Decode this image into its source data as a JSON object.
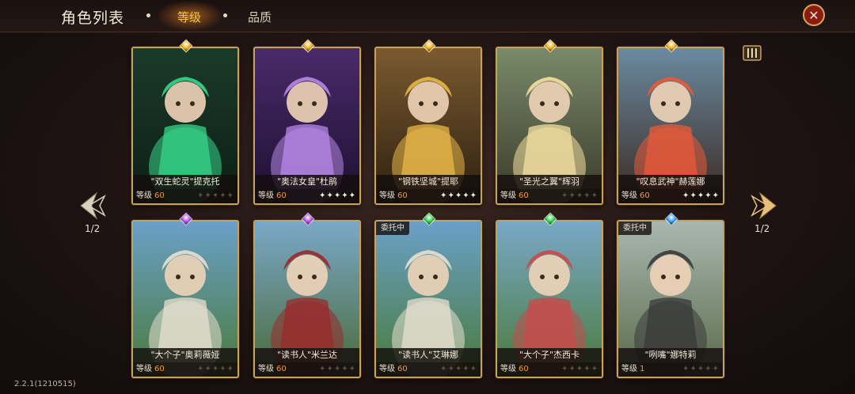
{
  "header": {
    "title": "角色列表",
    "tabs": [
      {
        "label": "等级",
        "active": true
      },
      {
        "label": "品质",
        "active": false
      }
    ],
    "close_icon": "close-icon"
  },
  "pagination": {
    "left": "1/2",
    "right": "1/2"
  },
  "version": "2.2.1(1210515)",
  "colors": {
    "accent": "#f5c24a",
    "level": "#f09a3a",
    "frame": "#c9a25a"
  },
  "cards": [
    {
      "name": "\"双生蛇灵\"提克托",
      "level_label": "等级",
      "level": "60",
      "stars": 0,
      "gem": "#f0b020",
      "tag": "",
      "bg": [
        "#1b3a2a",
        "#0d1f16"
      ],
      "accent": "#36d68a"
    },
    {
      "name": "\"奥法女皇\"杜鹃",
      "level_label": "等级",
      "level": "60",
      "stars": 5,
      "gem": "#f0b020",
      "tag": "",
      "bg": [
        "#4a2a6a",
        "#1c1030"
      ],
      "accent": "#b888e8"
    },
    {
      "name": "\"钢铁坚城\"提耶",
      "level_label": "等级",
      "level": "60",
      "stars": 5,
      "gem": "#f0b020",
      "tag": "",
      "bg": [
        "#7a5a30",
        "#2e2010"
      ],
      "accent": "#e8b848"
    },
    {
      "name": "\"圣光之翼\"辉羽",
      "level_label": "等级",
      "level": "60",
      "stars": 0,
      "gem": "#f0b020",
      "tag": "",
      "bg": [
        "#7a8a6a",
        "#3a3a28"
      ],
      "accent": "#f4e0a0"
    },
    {
      "name": "\"叹息武神\"赫莲娜",
      "level_label": "等级",
      "level": "60",
      "stars": 5,
      "gem": "#f0b020",
      "tag": "",
      "bg": [
        "#6a8aa0",
        "#3a2a22"
      ],
      "accent": "#e85a3a"
    },
    {
      "name": "\"大个子\"奥莉薇娅",
      "level_label": "等级",
      "level": "60",
      "stars": 0,
      "gem": "#b050e8",
      "tag": "",
      "bg": [
        "#6aa0c8",
        "#4a7a3a"
      ],
      "accent": "#e8e0d0"
    },
    {
      "name": "\"读书人\"米兰达",
      "level_label": "等级",
      "level": "60",
      "stars": 0,
      "gem": "#b050e8",
      "tag": "",
      "bg": [
        "#7aa8c8",
        "#4a6a3a"
      ],
      "accent": "#9a2a2a"
    },
    {
      "name": "\"读书人\"艾琳娜",
      "level_label": "等级",
      "level": "60",
      "stars": 0,
      "gem": "#30d050",
      "tag": "委托中",
      "bg": [
        "#6aa0c8",
        "#4a7a3a"
      ],
      "accent": "#e8e0d0"
    },
    {
      "name": "\"大个子\"杰西卡",
      "level_label": "等级",
      "level": "60",
      "stars": 0,
      "gem": "#30d050",
      "tag": "",
      "bg": [
        "#7aa8c8",
        "#4a7a3a"
      ],
      "accent": "#c84a4a"
    },
    {
      "name": "\"咧嘴\"娜特莉",
      "level_label": "等级",
      "level": "1",
      "stars": 0,
      "gem": "#30a0f0",
      "tag": "委托中",
      "bg": [
        "#a8b8b0",
        "#5a6a4a"
      ],
      "accent": "#3a3a3a"
    }
  ]
}
